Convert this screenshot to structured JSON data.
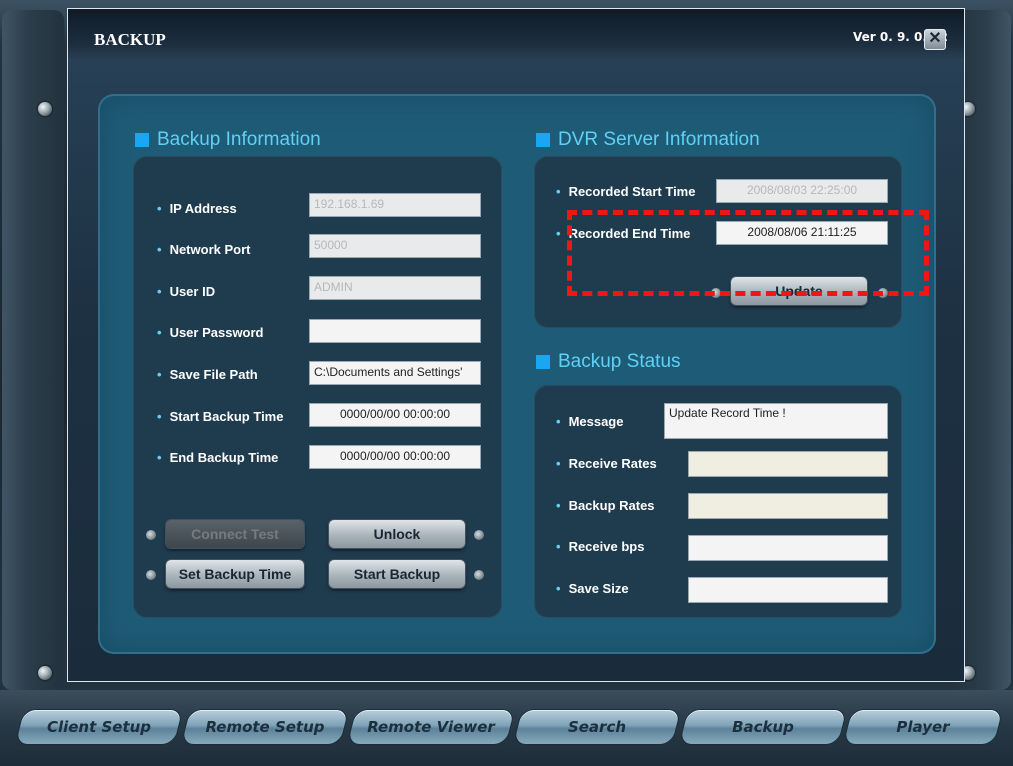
{
  "window": {
    "title": "BACKUP",
    "version": "Ver 0. 9. 0. 22",
    "close_symbol": "✕"
  },
  "backup_info": {
    "heading": "Backup Information",
    "fields": [
      {
        "label": "IP Address",
        "value": "192.168.1.69",
        "enabled": false
      },
      {
        "label": "Network Port",
        "value": "50000",
        "enabled": false
      },
      {
        "label": "User ID",
        "value": "ADMIN",
        "enabled": false
      },
      {
        "label": "User Password",
        "value": "",
        "enabled": true
      },
      {
        "label": "Save File Path",
        "value": "C:\\Documents and Settings'",
        "enabled": true
      },
      {
        "label": "Start Backup Time",
        "value": "0000/00/00 00:00:00",
        "enabled": true
      },
      {
        "label": "End Backup Time",
        "value": "0000/00/00 00:00:00",
        "enabled": true
      }
    ],
    "buttons": {
      "connect_test": "Connect Test",
      "unlock": "Unlock",
      "set_backup_time": "Set Backup Time",
      "start_backup": "Start Backup"
    }
  },
  "dvr_info": {
    "heading": "DVR Server Information",
    "recorded_start_label": "Recorded Start Time",
    "recorded_start_value": "2008/08/03 22:25:00",
    "recorded_end_label": "Recorded End Time",
    "recorded_end_value": "2008/08/06 21:11:25",
    "update_button": "Update"
  },
  "backup_status": {
    "heading": "Backup Status",
    "message_label": "Message",
    "message_value": "Update Record Time !",
    "receive_rates_label": "Receive Rates",
    "receive_rates_value": "",
    "backup_rates_label": "Backup Rates",
    "backup_rates_value": "",
    "receive_bps_label": "Receive bps",
    "receive_bps_value": "",
    "save_size_label": "Save Size",
    "save_size_value": ""
  },
  "nav": {
    "items": [
      "Client Setup",
      "Remote Setup",
      "Remote Viewer",
      "Search",
      "Backup",
      "Player"
    ]
  },
  "colors": {
    "accent": "#1aa7f2",
    "heading": "#5fd1f5",
    "panel": "#1e5b76",
    "highlight": "#f01616"
  }
}
